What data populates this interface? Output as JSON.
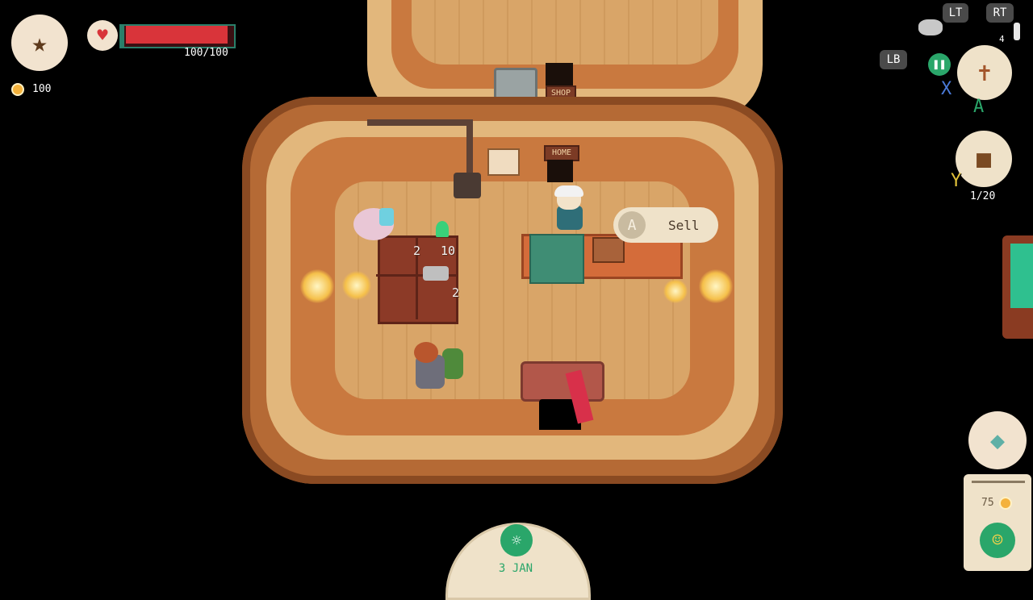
{
  "hud": {
    "hp_text": "100/100",
    "hp_fraction": 1.0,
    "gold": "100",
    "inventory_count": "1/20",
    "shop_price": "75",
    "colors": {
      "hp": "#d9343a",
      "accent": "#2aa66a",
      "panel": "#efe2c9"
    }
  },
  "buttons": {
    "lt": "LT",
    "rt": "RT",
    "lb": "LB",
    "x": "X",
    "a": "A",
    "y": "Y",
    "rt_count": "4"
  },
  "prompt": {
    "button": "A",
    "action": "Sell"
  },
  "scene": {
    "sign_home": "HOME",
    "sign_shop": "SHOP",
    "table_numbers": [
      "2",
      "10",
      "2"
    ]
  },
  "calendar": {
    "date": "3 JAN"
  },
  "icons": {
    "avatar": "familiar-icon",
    "heart": "heart-icon",
    "coin": "coin-icon",
    "broom": "broom-tool-icon",
    "bag": "backpack-icon",
    "gem": "crystal-icon",
    "pause": "pause-icon",
    "day": "day-cycle-icon"
  }
}
